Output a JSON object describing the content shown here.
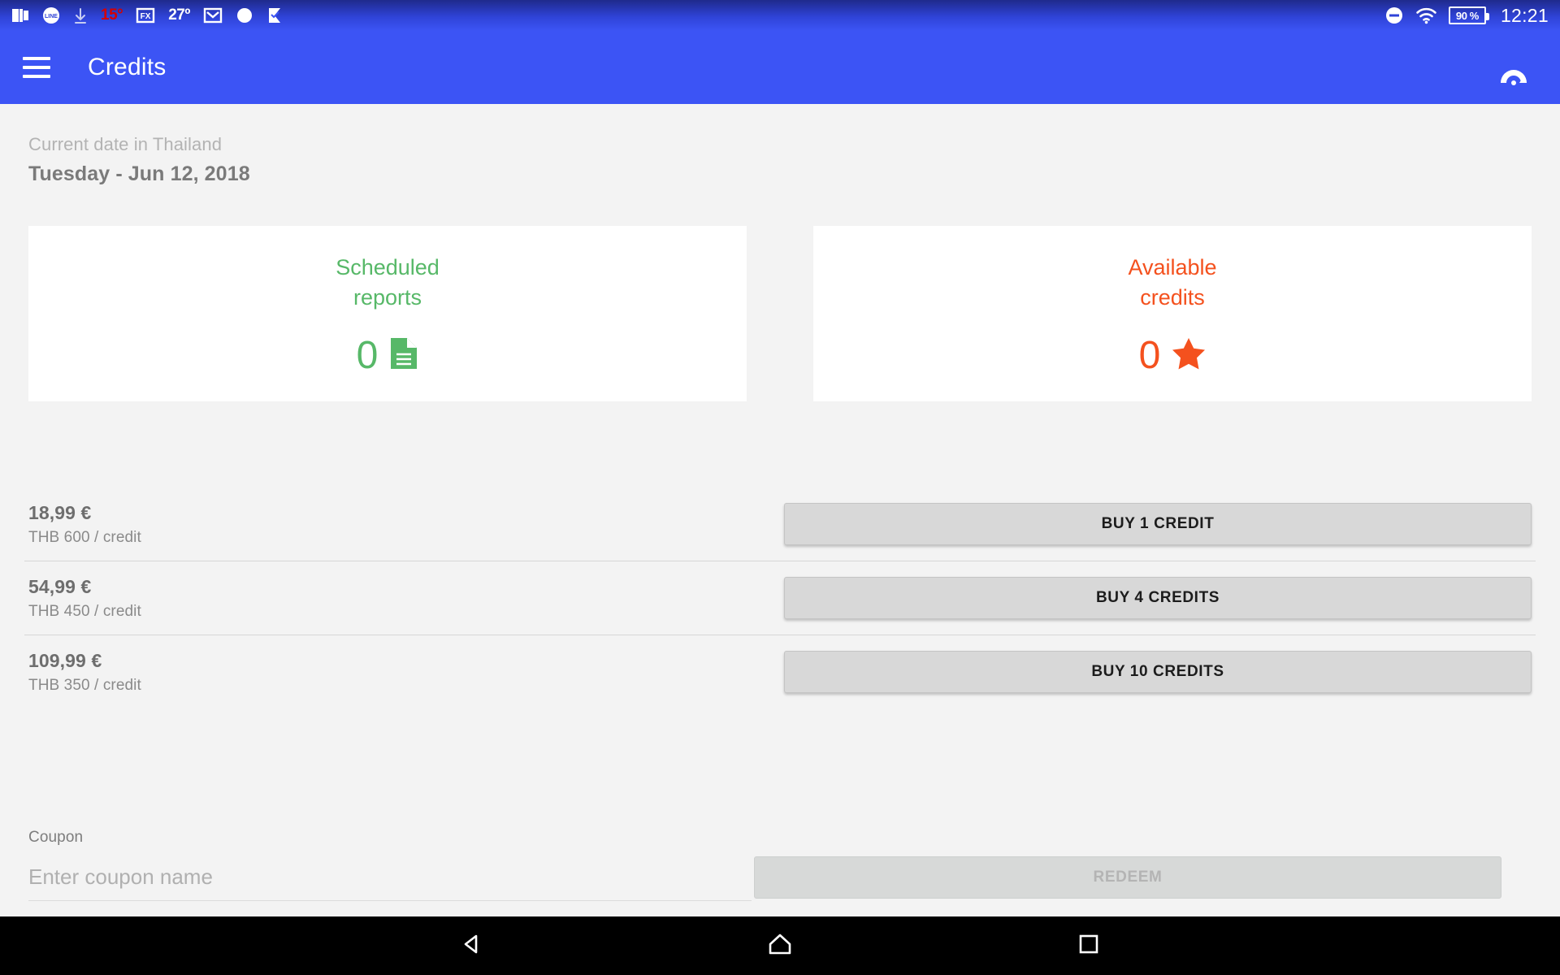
{
  "statusbar": {
    "left_icons": [
      "app-shortcut-icon",
      "line-app-icon",
      "download-arrow-icon",
      "temperature-alert-icon",
      "file-explorer-icon",
      "weather-temp-icon",
      "gmail-icon",
      "circle-icon",
      "checkmark-flag-icon"
    ],
    "temp_alert": "15°",
    "temp_weather": "27º",
    "dnd_icon": "do-not-disturb-icon",
    "wifi_icon": "wifi-icon",
    "battery": "90 %",
    "clock": "12:21"
  },
  "appbar": {
    "menu_icon": "hamburger-menu-icon",
    "title": "Credits",
    "action_icon": "restore-purchases-icon"
  },
  "date": {
    "label": "Current date in Thailand",
    "value": "Tuesday - Jun 12, 2018"
  },
  "cards": [
    {
      "title": "Scheduled\nreports",
      "title_line1": "Scheduled",
      "title_line2": "reports",
      "value": "0",
      "icon": "document-icon",
      "color": "#57b868"
    },
    {
      "title": "Available\ncredits",
      "title_line1": "Available",
      "title_line2": "credits",
      "value": "0",
      "icon": "star-icon",
      "color": "#f4511e"
    }
  ],
  "prices": [
    {
      "amount": "18,99 €",
      "rate": "THB 600 / credit",
      "button": "BUY 1 CREDIT"
    },
    {
      "amount": "54,99 €",
      "rate": "THB 450 / credit",
      "button": "BUY 4 CREDITS"
    },
    {
      "amount": "109,99 €",
      "rate": "THB 350 / credit",
      "button": "BUY 10 CREDITS"
    }
  ],
  "coupon": {
    "label": "Coupon",
    "value": "",
    "placeholder": "Enter coupon name",
    "redeem_label": "REDEEM"
  },
  "navbar": {
    "back": "back-triangle-icon",
    "home": "home-icon",
    "recents": "recents-square-icon"
  }
}
